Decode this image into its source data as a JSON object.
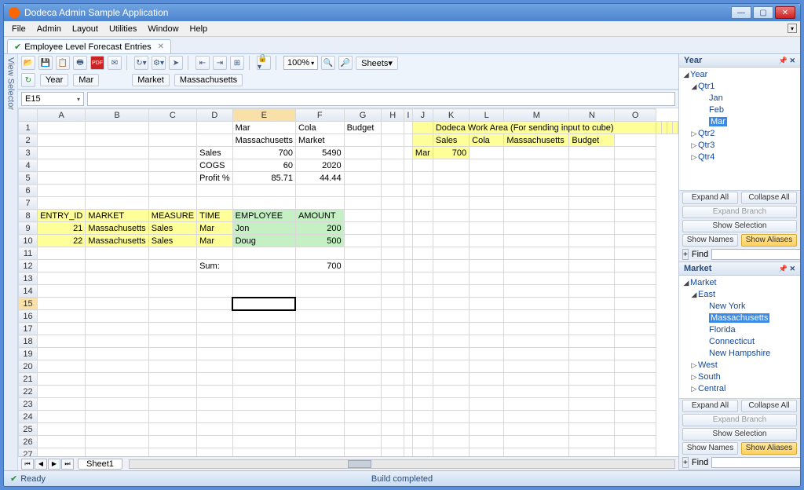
{
  "window": {
    "title": "Dodeca Admin Sample Application"
  },
  "menu": [
    "File",
    "Admin",
    "Layout",
    "Utilities",
    "Window",
    "Help"
  ],
  "tab": {
    "label": "Employee Level Forecast Entries"
  },
  "sidetab": "View Selector",
  "toolbar": {
    "zoom": "100%",
    "sheets": "Sheets"
  },
  "sel": {
    "year": "Year",
    "mar": "Mar",
    "market": "Market",
    "mass": "Massachusetts"
  },
  "cellref": "E15",
  "cols": [
    "A",
    "B",
    "C",
    "D",
    "E",
    "F",
    "G",
    "H",
    "I",
    "J",
    "K",
    "L",
    "M",
    "N",
    "O"
  ],
  "rows": 28,
  "cells": {
    "E1": "Mar",
    "F1": "Cola",
    "G1": "Budget",
    "K1": "Dodeca Work Area (For sending input to cube)",
    "E2": "Massachusetts",
    "F2": "Market",
    "K2": "Sales",
    "L2": "Cola",
    "M2": "Massachusetts",
    "N2": "Budget",
    "D3": "Sales",
    "E3v": "700",
    "F3v": "5490",
    "J3": "Mar",
    "K3v": "700",
    "D4": "COGS",
    "E4v": "60",
    "F4v": "2020",
    "D5": "Profit %",
    "E5v": "85.71",
    "F5v": "44.44",
    "A8": "ENTRY_ID",
    "B8": "MARKET",
    "C8": "MEASURE",
    "D8": "TIME",
    "E8": "EMPLOYEE",
    "F8": "AMOUNT",
    "A9v": "21",
    "B9": "Massachusetts",
    "C9": "Sales",
    "D9": "Mar",
    "E9": "Jon",
    "F9v": "200",
    "A10v": "22",
    "B10": "Massachusetts",
    "C10": "Sales",
    "D10": "Mar",
    "E10": "Doug",
    "F10v": "500",
    "D12": "Sum:",
    "F12v": "700"
  },
  "sheet": "Sheet1",
  "panelYear": {
    "title": "Year",
    "root": "Year",
    "q1": "Qtr1",
    "jan": "Jan",
    "feb": "Feb",
    "mar": "Mar",
    "q2": "Qtr2",
    "q3": "Qtr3",
    "q4": "Qtr4"
  },
  "panelMarket": {
    "title": "Market",
    "root": "Market",
    "east": "East",
    "ny": "New York",
    "ma": "Massachusetts",
    "fl": "Florida",
    "ct": "Connecticut",
    "nh": "New Hampshire",
    "west": "West",
    "south": "South",
    "central": "Central"
  },
  "panelBtns": {
    "expand": "Expand All",
    "collapse": "Collapse All",
    "branch": "Expand Branch",
    "showsel": "Show Selection",
    "names": "Show Names",
    "aliases": "Show Aliases",
    "find": "Find"
  },
  "status": {
    "ready": "Ready",
    "build": "Build completed"
  }
}
